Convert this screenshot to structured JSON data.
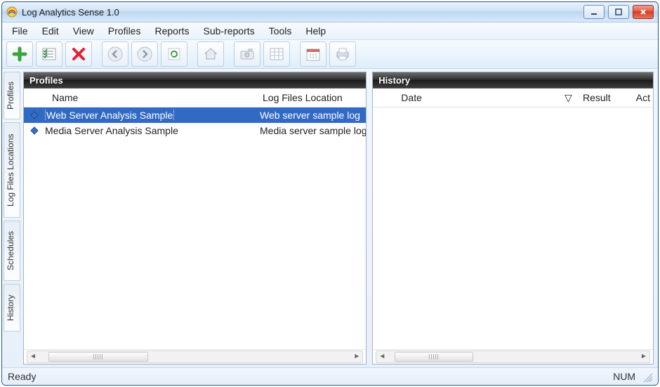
{
  "window": {
    "title": "Log Analytics Sense 1.0"
  },
  "menu": {
    "items": [
      "File",
      "Edit",
      "View",
      "Profiles",
      "Reports",
      "Sub-reports",
      "Tools",
      "Help"
    ]
  },
  "toolbar_icons": [
    "add",
    "checklist",
    "delete",
    "back",
    "forward",
    "refresh",
    "home",
    "camera",
    "grid",
    "calendar",
    "print"
  ],
  "sidetabs": [
    "Profiles",
    "Log Files Locations",
    "Schedules",
    "History"
  ],
  "profiles_panel": {
    "title": "Profiles",
    "columns": {
      "name": "Name",
      "location": "Log Files Location"
    },
    "rows": [
      {
        "name": "Web Server Analysis Sample",
        "location": "Web server sample log",
        "selected": true
      },
      {
        "name": "Media Server Analysis Sample",
        "location": "Media server sample log",
        "selected": false
      }
    ]
  },
  "history_panel": {
    "title": "History",
    "columns": {
      "date": "Date",
      "sort_icon": "▽",
      "result": "Result",
      "actions": "Act"
    }
  },
  "status": {
    "left": "Ready",
    "right": "NUM"
  }
}
